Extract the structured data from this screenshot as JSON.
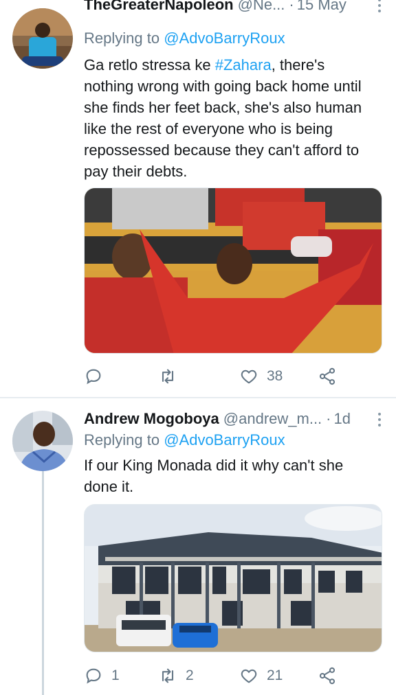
{
  "tweets": [
    {
      "name": "TheGreaterNapoleon",
      "handle": "@Ne...",
      "separator": "·",
      "date": "15 May",
      "replying_prefix": "Replying to",
      "replying_to": "@AdvoBarryRoux",
      "text_before": "Ga retlo stressa ke ",
      "hashtag": "#Zahara",
      "text_after": ", there's nothing wrong with going back home until she finds her feet back, she's also human like the rest of everyone who is being repossessed because they can't afford to pay their debts.",
      "reply_count": "",
      "retweet_count": "",
      "like_count": "38"
    },
    {
      "name": "Andrew Mogoboya",
      "handle": "@andrew_m...",
      "separator": "·",
      "date": "1d",
      "replying_prefix": "Replying to",
      "replying_to": "@AdvoBarryRoux",
      "text": "If our King Monada did it why can't she done it.",
      "reply_count": "1",
      "retweet_count": "2",
      "like_count": "21"
    }
  ],
  "colors": {
    "accent": "#1da1f2",
    "secondary_text": "#657786",
    "divider": "#e6ecf0"
  },
  "icons": [
    "reply-icon",
    "retweet-icon",
    "like-icon",
    "share-icon",
    "more-icon"
  ]
}
